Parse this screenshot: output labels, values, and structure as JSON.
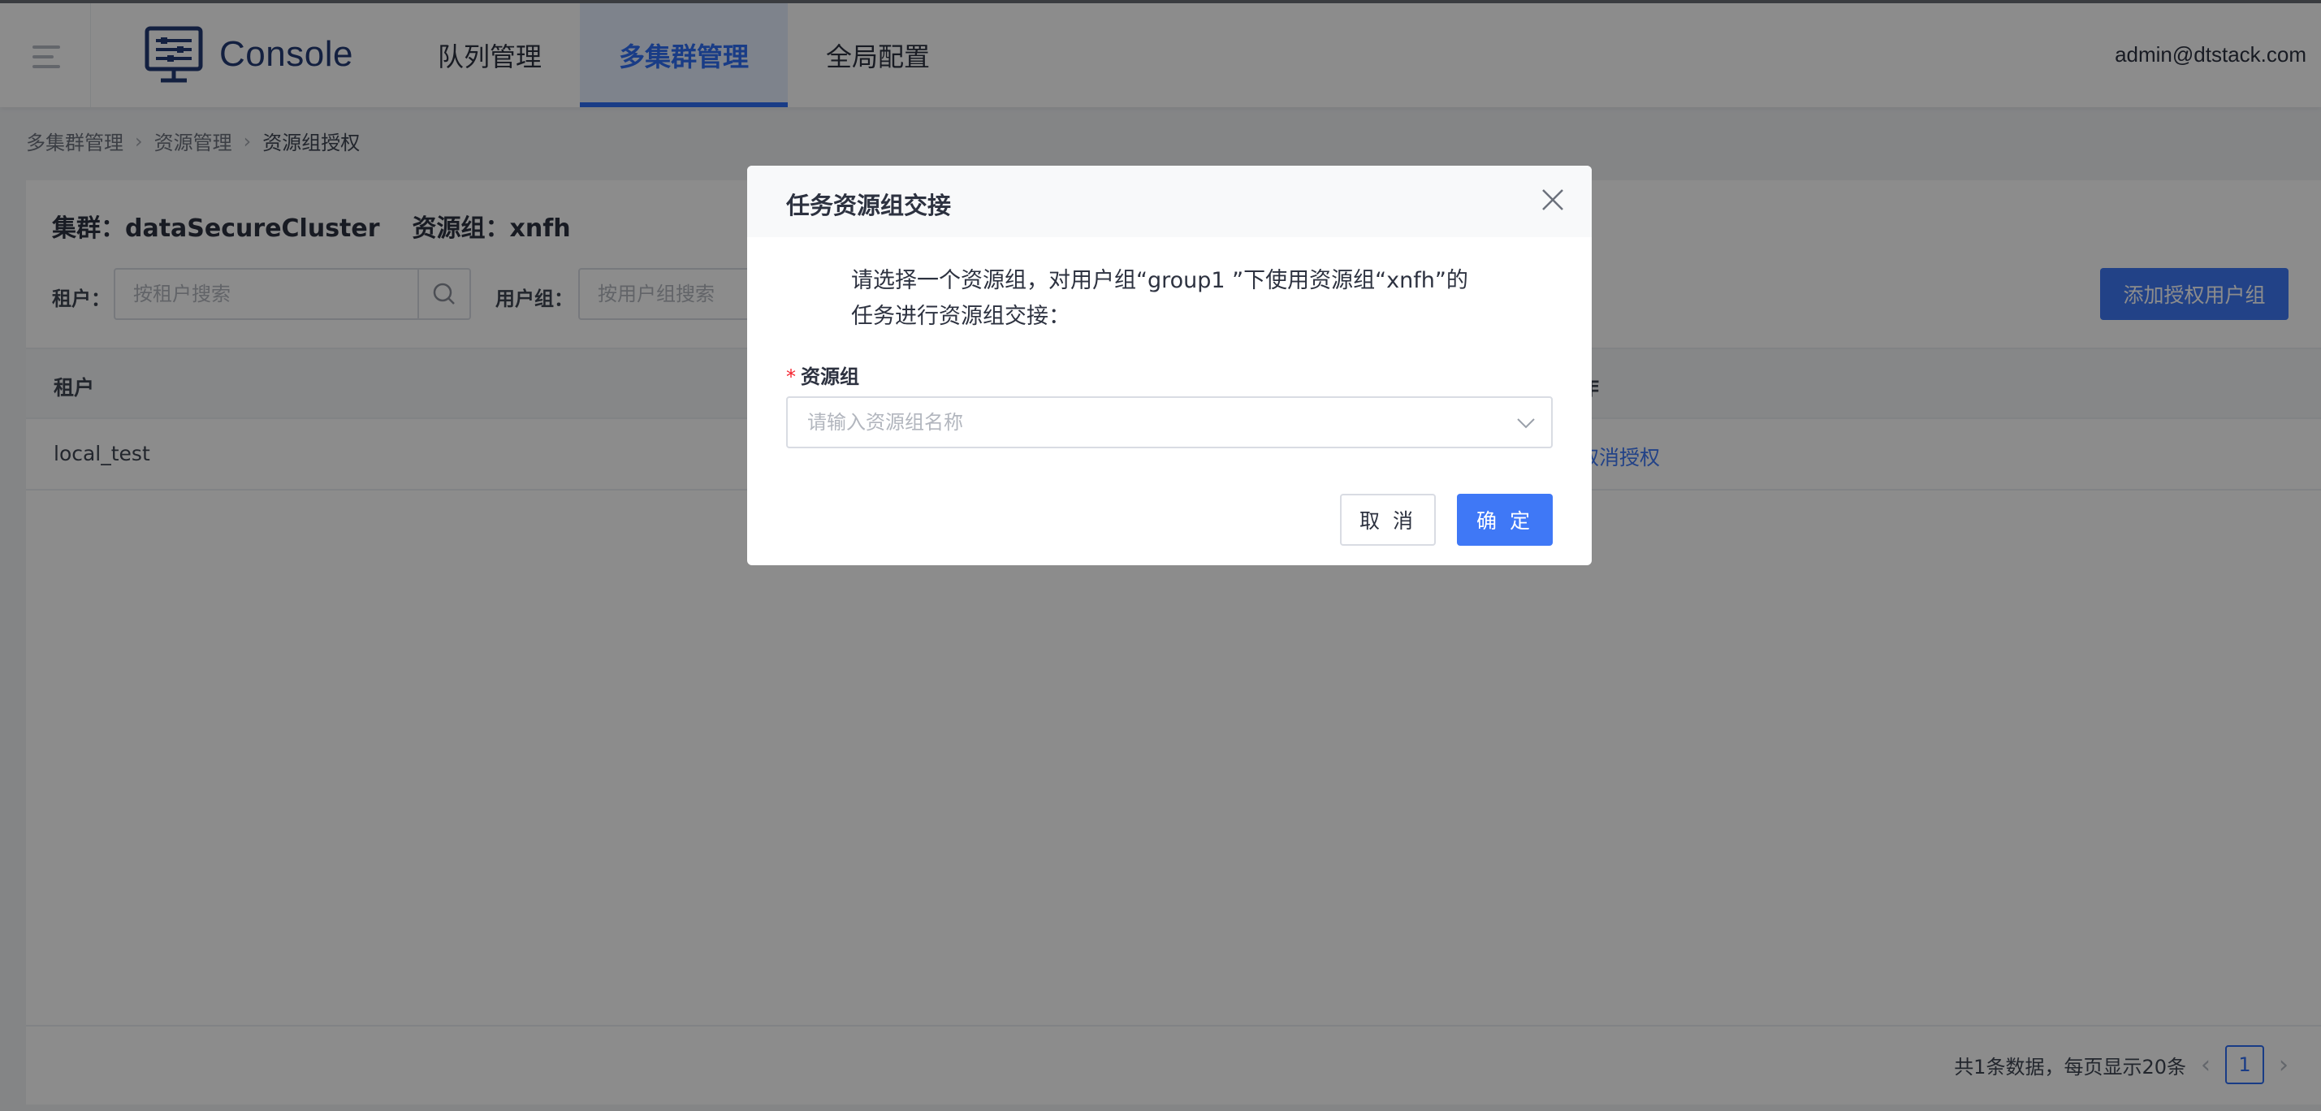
{
  "header": {
    "brand": "Console",
    "nav": [
      {
        "label": "队列管理",
        "active": false
      },
      {
        "label": "多集群管理",
        "active": true
      },
      {
        "label": "全局配置",
        "active": false
      }
    ],
    "user": "admin@dtstack.com"
  },
  "breadcrumb": [
    "多集群管理",
    "资源管理",
    "资源组授权"
  ],
  "card": {
    "cluster_label": "集群：dataSecureCluster",
    "resource_group_label": "资源组：xnfh",
    "tenant_filter_label": "租户：",
    "tenant_filter_placeholder": "按租户搜索",
    "usergroup_filter_label": "用户组：",
    "usergroup_filter_placeholder": "按用户组搜索",
    "add_button": "添加授权用户组"
  },
  "table": {
    "columns": [
      "租户",
      "作"
    ],
    "rows": [
      {
        "tenant": "local_test",
        "action": "取消授权"
      }
    ]
  },
  "pagination": {
    "summary": "共1条数据，每页显示20条",
    "current_page": "1"
  },
  "modal": {
    "title": "任务资源组交接",
    "description_line1": "请选择一个资源组，对用户组“group1 ”下使用资源组“xnfh”的",
    "description_line2": "任务进行资源组交接：",
    "field_label": "资源组",
    "select_placeholder": "请输入资源组名称",
    "cancel": "取 消",
    "ok": "确 定"
  },
  "colors": {
    "primary": "#3f78f6",
    "active_nav_bg": "#e6efff",
    "required": "#f5222d",
    "overlay": "rgba(0,0,0,0.45)"
  }
}
